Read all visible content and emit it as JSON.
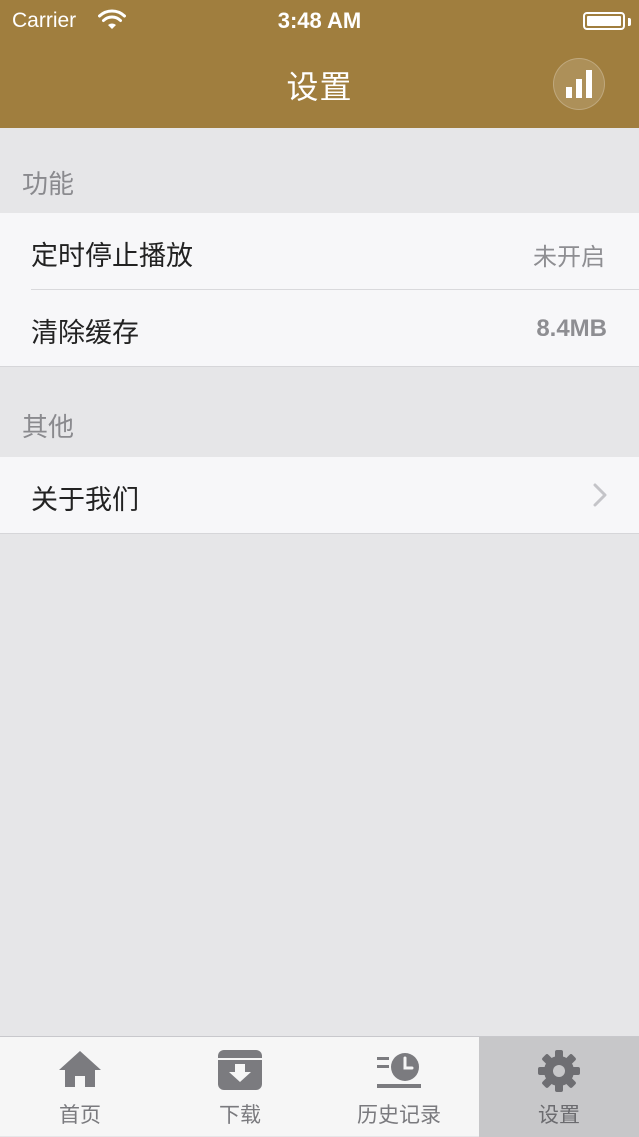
{
  "status_bar": {
    "carrier": "Carrier",
    "time": "3:48 AM"
  },
  "nav": {
    "title": "设置",
    "right_icon": "bar-chart-icon"
  },
  "sections": [
    {
      "header": "功能",
      "rows": [
        {
          "label": "定时停止播放",
          "value": "未开启"
        },
        {
          "label": "清除缓存",
          "value": "8.4MB"
        }
      ]
    },
    {
      "header": "其他",
      "rows": [
        {
          "label": "关于我们",
          "accessory": "chevron-right-icon"
        }
      ]
    }
  ],
  "tabs": [
    {
      "label": "首页",
      "icon": "home-icon"
    },
    {
      "label": "下载",
      "icon": "download-box-icon"
    },
    {
      "label": "历史记录",
      "icon": "history-clock-icon"
    },
    {
      "label": "设置",
      "icon": "gear-icon",
      "active": true
    }
  ],
  "colors": {
    "header_bg": "#a07e3e",
    "page_bg": "#e6e6e8",
    "row_bg": "#f7f7f9",
    "tab_active_bg": "#c7c7c9",
    "icon_gray": "#7b7b7f"
  }
}
